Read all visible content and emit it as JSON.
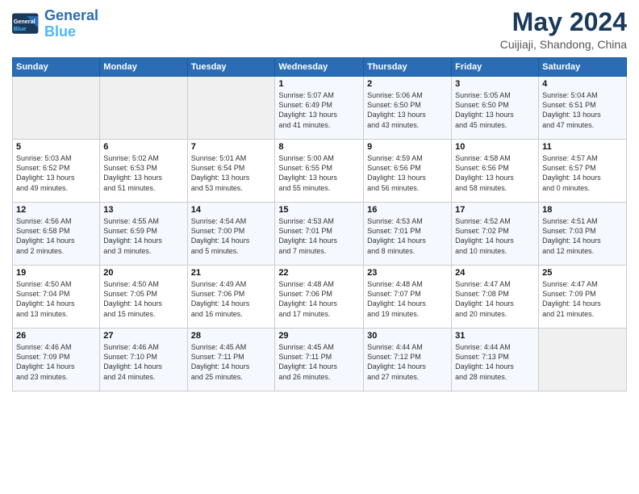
{
  "header": {
    "logo_line1": "General",
    "logo_line2": "Blue",
    "month_title": "May 2024",
    "location": "Cuijiaji, Shandong, China"
  },
  "weekdays": [
    "Sunday",
    "Monday",
    "Tuesday",
    "Wednesday",
    "Thursday",
    "Friday",
    "Saturday"
  ],
  "weeks": [
    [
      {
        "day": "",
        "info": ""
      },
      {
        "day": "",
        "info": ""
      },
      {
        "day": "",
        "info": ""
      },
      {
        "day": "1",
        "info": "Sunrise: 5:07 AM\nSunset: 6:49 PM\nDaylight: 13 hours\nand 41 minutes."
      },
      {
        "day": "2",
        "info": "Sunrise: 5:06 AM\nSunset: 6:50 PM\nDaylight: 13 hours\nand 43 minutes."
      },
      {
        "day": "3",
        "info": "Sunrise: 5:05 AM\nSunset: 6:50 PM\nDaylight: 13 hours\nand 45 minutes."
      },
      {
        "day": "4",
        "info": "Sunrise: 5:04 AM\nSunset: 6:51 PM\nDaylight: 13 hours\nand 47 minutes."
      }
    ],
    [
      {
        "day": "5",
        "info": "Sunrise: 5:03 AM\nSunset: 6:52 PM\nDaylight: 13 hours\nand 49 minutes."
      },
      {
        "day": "6",
        "info": "Sunrise: 5:02 AM\nSunset: 6:53 PM\nDaylight: 13 hours\nand 51 minutes."
      },
      {
        "day": "7",
        "info": "Sunrise: 5:01 AM\nSunset: 6:54 PM\nDaylight: 13 hours\nand 53 minutes."
      },
      {
        "day": "8",
        "info": "Sunrise: 5:00 AM\nSunset: 6:55 PM\nDaylight: 13 hours\nand 55 minutes."
      },
      {
        "day": "9",
        "info": "Sunrise: 4:59 AM\nSunset: 6:56 PM\nDaylight: 13 hours\nand 56 minutes."
      },
      {
        "day": "10",
        "info": "Sunrise: 4:58 AM\nSunset: 6:56 PM\nDaylight: 13 hours\nand 58 minutes."
      },
      {
        "day": "11",
        "info": "Sunrise: 4:57 AM\nSunset: 6:57 PM\nDaylight: 14 hours\nand 0 minutes."
      }
    ],
    [
      {
        "day": "12",
        "info": "Sunrise: 4:56 AM\nSunset: 6:58 PM\nDaylight: 14 hours\nand 2 minutes."
      },
      {
        "day": "13",
        "info": "Sunrise: 4:55 AM\nSunset: 6:59 PM\nDaylight: 14 hours\nand 3 minutes."
      },
      {
        "day": "14",
        "info": "Sunrise: 4:54 AM\nSunset: 7:00 PM\nDaylight: 14 hours\nand 5 minutes."
      },
      {
        "day": "15",
        "info": "Sunrise: 4:53 AM\nSunset: 7:01 PM\nDaylight: 14 hours\nand 7 minutes."
      },
      {
        "day": "16",
        "info": "Sunrise: 4:53 AM\nSunset: 7:01 PM\nDaylight: 14 hours\nand 8 minutes."
      },
      {
        "day": "17",
        "info": "Sunrise: 4:52 AM\nSunset: 7:02 PM\nDaylight: 14 hours\nand 10 minutes."
      },
      {
        "day": "18",
        "info": "Sunrise: 4:51 AM\nSunset: 7:03 PM\nDaylight: 14 hours\nand 12 minutes."
      }
    ],
    [
      {
        "day": "19",
        "info": "Sunrise: 4:50 AM\nSunset: 7:04 PM\nDaylight: 14 hours\nand 13 minutes."
      },
      {
        "day": "20",
        "info": "Sunrise: 4:50 AM\nSunset: 7:05 PM\nDaylight: 14 hours\nand 15 minutes."
      },
      {
        "day": "21",
        "info": "Sunrise: 4:49 AM\nSunset: 7:06 PM\nDaylight: 14 hours\nand 16 minutes."
      },
      {
        "day": "22",
        "info": "Sunrise: 4:48 AM\nSunset: 7:06 PM\nDaylight: 14 hours\nand 17 minutes."
      },
      {
        "day": "23",
        "info": "Sunrise: 4:48 AM\nSunset: 7:07 PM\nDaylight: 14 hours\nand 19 minutes."
      },
      {
        "day": "24",
        "info": "Sunrise: 4:47 AM\nSunset: 7:08 PM\nDaylight: 14 hours\nand 20 minutes."
      },
      {
        "day": "25",
        "info": "Sunrise: 4:47 AM\nSunset: 7:09 PM\nDaylight: 14 hours\nand 21 minutes."
      }
    ],
    [
      {
        "day": "26",
        "info": "Sunrise: 4:46 AM\nSunset: 7:09 PM\nDaylight: 14 hours\nand 23 minutes."
      },
      {
        "day": "27",
        "info": "Sunrise: 4:46 AM\nSunset: 7:10 PM\nDaylight: 14 hours\nand 24 minutes."
      },
      {
        "day": "28",
        "info": "Sunrise: 4:45 AM\nSunset: 7:11 PM\nDaylight: 14 hours\nand 25 minutes."
      },
      {
        "day": "29",
        "info": "Sunrise: 4:45 AM\nSunset: 7:11 PM\nDaylight: 14 hours\nand 26 minutes."
      },
      {
        "day": "30",
        "info": "Sunrise: 4:44 AM\nSunset: 7:12 PM\nDaylight: 14 hours\nand 27 minutes."
      },
      {
        "day": "31",
        "info": "Sunrise: 4:44 AM\nSunset: 7:13 PM\nDaylight: 14 hours\nand 28 minutes."
      },
      {
        "day": "",
        "info": ""
      }
    ]
  ]
}
